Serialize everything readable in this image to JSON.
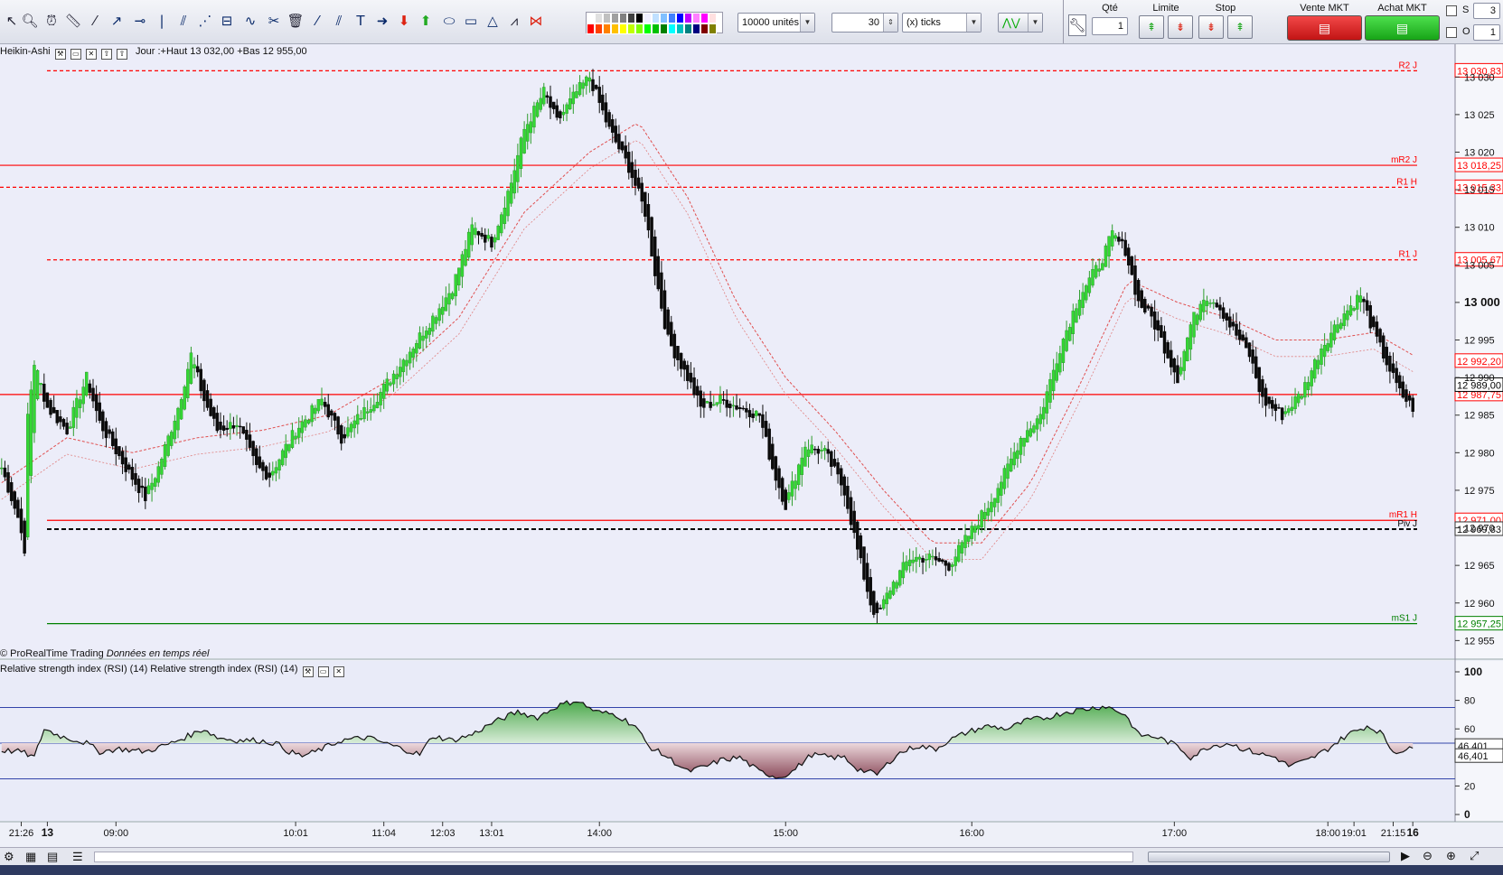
{
  "toolbar": {
    "quantity_combo": "10000 unités",
    "ticks_value": "30",
    "ticks_unit": "(x) ticks",
    "qty_label": "Qté",
    "qty_value": "1",
    "limit_label": "Limite",
    "stop_label": "Stop",
    "sell_label": "Vente MKT",
    "buy_label": "Achat MKT",
    "s_label": "S",
    "s_value": "3",
    "o_label": "O",
    "o_value": "1",
    "colors_row1": [
      "#ffffff",
      "#e0e0e0",
      "#c0c0c0",
      "#a0a0a0",
      "#808080",
      "#404040",
      "#000000",
      "#f0f0ff",
      "#c0e0ff",
      "#80c0ff",
      "#4080ff",
      "#0000ff",
      "#c000ff",
      "#ff80ff",
      "#ff00ff",
      "#ffe0e0"
    ],
    "colors_row2": [
      "#ff0000",
      "#ff4000",
      "#ff8000",
      "#ffc000",
      "#ffff00",
      "#c0ff00",
      "#80ff00",
      "#00ff00",
      "#00c000",
      "#008000",
      "#00ffff",
      "#00c0c0",
      "#008080",
      "#000080",
      "#800000",
      "#808000"
    ]
  },
  "chart_header": {
    "indicator": "Heikin-Ashi",
    "day_info": "Jour :+Haut 13 032,00 +Bas 12 955,00"
  },
  "rsi_header": {
    "title": "Relative strength index (RSI) (14) Relative strength index (RSI) (14)"
  },
  "vendor": {
    "name": "© ProRealTime Trading",
    "data_note": "Données en temps réel"
  },
  "chart_data": [
    {
      "type": "candlestick",
      "style": "Heikin-Ashi",
      "ylim": [
        12953,
        13034
      ],
      "y_ticks": [
        12955,
        12960,
        12965,
        12970,
        12975,
        12980,
        12985,
        12990,
        12995,
        13000,
        13005,
        13010,
        13015,
        13020,
        13025,
        13030
      ],
      "y_tick_labels": [
        "12 955",
        "12 960",
        "12 965",
        "12 970",
        "12 975",
        "12 980",
        "12 985",
        "12 990",
        "12 995",
        "13 000",
        "13 005",
        "13 010",
        "13 015",
        "13 020",
        "13 025",
        "13 030"
      ],
      "x_tick_labels": [
        "21:26",
        "13",
        "09:00",
        "10:01",
        "11:04",
        "12:03",
        "13:01",
        "14:00",
        "15:00",
        "16:00",
        "17:00",
        "18:00",
        "19:01",
        "21:15",
        "16"
      ],
      "levels": [
        {
          "name": "R2 J",
          "value": 13030.83,
          "label": "13 030,83",
          "color": "#ff0000",
          "style": "dashed"
        },
        {
          "name": "mR2 J",
          "value": 13018.25,
          "label": "13 018,25",
          "color": "#ff0000",
          "style": "solid"
        },
        {
          "name": "R1 H",
          "value": 13015.33,
          "label": "13 015,33",
          "color": "#ff0000",
          "style": "dashed"
        },
        {
          "name": "R1 J",
          "value": 13005.67,
          "label": "13 005,67",
          "color": "#ff0000",
          "style": "dashed"
        },
        {
          "name": "",
          "value": 12987.75,
          "label": "12 987,75",
          "color": "#ff0000",
          "style": "solid"
        },
        {
          "name": "mR1 H",
          "value": 12971.0,
          "label": "12 971,00",
          "color": "#ff0000",
          "style": "solid"
        },
        {
          "name": "Piv J",
          "value": 12969.83,
          "label": "12 969,83",
          "color": "#000000",
          "style": "dashed"
        },
        {
          "name": "mS1 J",
          "value": 12957.25,
          "label": "12 957,25",
          "color": "#008000",
          "style": "solid"
        }
      ],
      "markers": [
        {
          "value": 12992.2,
          "label": "12 992,20",
          "color": "#ff0000"
        },
        {
          "value": 12989.0,
          "label": "12 989,00",
          "color": "#000000"
        }
      ],
      "path": [
        [
          0,
          12978
        ],
        [
          3,
          12974
        ],
        [
          6,
          12970
        ],
        [
          7,
          12966
        ],
        [
          8,
          12985
        ],
        [
          10,
          12992
        ],
        [
          14,
          12986
        ],
        [
          20,
          12983
        ],
        [
          26,
          12990
        ],
        [
          30,
          12984
        ],
        [
          38,
          12978
        ],
        [
          44,
          12974
        ],
        [
          48,
          12978
        ],
        [
          54,
          12986
        ],
        [
          58,
          12993
        ],
        [
          62,
          12987
        ],
        [
          66,
          12983
        ],
        [
          72,
          12984
        ],
        [
          78,
          12978
        ],
        [
          82,
          12977
        ],
        [
          90,
          12983
        ],
        [
          98,
          12987
        ],
        [
          104,
          12982
        ],
        [
          108,
          12984
        ],
        [
          116,
          12988
        ],
        [
          124,
          12993
        ],
        [
          132,
          12998
        ],
        [
          138,
          13002
        ],
        [
          144,
          13010
        ],
        [
          150,
          13008
        ],
        [
          156,
          13016
        ],
        [
          160,
          13023
        ],
        [
          166,
          13028
        ],
        [
          170,
          13024
        ],
        [
          176,
          13028
        ],
        [
          180,
          13030
        ],
        [
          186,
          13023
        ],
        [
          192,
          13018
        ],
        [
          197,
          13012
        ],
        [
          200,
          13004
        ],
        [
          204,
          12995
        ],
        [
          210,
          12990
        ],
        [
          214,
          12986
        ],
        [
          220,
          12987
        ],
        [
          226,
          12986
        ],
        [
          232,
          12985
        ],
        [
          236,
          12978
        ],
        [
          240,
          12973
        ],
        [
          246,
          12981
        ],
        [
          252,
          12980
        ],
        [
          258,
          12975
        ],
        [
          262,
          12967
        ],
        [
          266,
          12960
        ],
        [
          268,
          12958
        ],
        [
          272,
          12962
        ],
        [
          278,
          12966
        ],
        [
          284,
          12966
        ],
        [
          290,
          12965
        ],
        [
          296,
          12969
        ],
        [
          302,
          12973
        ],
        [
          308,
          12978
        ],
        [
          312,
          12982
        ],
        [
          318,
          12985
        ],
        [
          324,
          12994
        ],
        [
          330,
          13001
        ],
        [
          336,
          13005
        ],
        [
          340,
          13009
        ],
        [
          344,
          13007
        ],
        [
          348,
          13000
        ],
        [
          352,
          12998
        ],
        [
          356,
          12994
        ],
        [
          360,
          12990
        ],
        [
          364,
          12997
        ],
        [
          368,
          13001
        ],
        [
          372,
          13000
        ],
        [
          376,
          12997
        ],
        [
          382,
          12993
        ],
        [
          386,
          12987
        ],
        [
          392,
          12985
        ],
        [
          398,
          12988
        ],
        [
          404,
          12994
        ],
        [
          410,
          12998
        ],
        [
          416,
          13001
        ],
        [
          420,
          12996
        ],
        [
          424,
          12992
        ],
        [
          428,
          12988
        ],
        [
          432,
          12986
        ]
      ],
      "sma_path": [
        [
          0,
          12976
        ],
        [
          20,
          12982
        ],
        [
          40,
          12980
        ],
        [
          60,
          12982
        ],
        [
          80,
          12983
        ],
        [
          100,
          12985
        ],
        [
          120,
          12990
        ],
        [
          140,
          12998
        ],
        [
          160,
          13012
        ],
        [
          180,
          13020
        ],
        [
          195,
          13024
        ],
        [
          210,
          13014
        ],
        [
          225,
          13000
        ],
        [
          240,
          12990
        ],
        [
          255,
          12983
        ],
        [
          270,
          12975
        ],
        [
          285,
          12968
        ],
        [
          300,
          12968
        ],
        [
          315,
          12976
        ],
        [
          330,
          12989
        ],
        [
          345,
          13003
        ],
        [
          360,
          13000
        ],
        [
          375,
          12998
        ],
        [
          390,
          12995
        ],
        [
          405,
          12995
        ],
        [
          420,
          12996
        ],
        [
          432,
          12993
        ]
      ]
    },
    {
      "type": "area",
      "name": "RSI (14)",
      "ylim": [
        0,
        100
      ],
      "y_ticks": [
        0,
        20,
        40,
        60,
        80,
        100
      ],
      "y_tick_labels": [
        "0",
        "20",
        "40",
        "60",
        "80",
        "100"
      ],
      "levels": [
        25,
        50,
        75
      ],
      "value_label": "46,401",
      "values": [
        [
          0,
          45
        ],
        [
          6,
          44
        ],
        [
          10,
          40
        ],
        [
          13,
          60
        ],
        [
          18,
          55
        ],
        [
          26,
          50
        ],
        [
          30,
          44
        ],
        [
          36,
          46
        ],
        [
          44,
          44
        ],
        [
          52,
          50
        ],
        [
          58,
          56
        ],
        [
          62,
          60
        ],
        [
          66,
          54
        ],
        [
          72,
          52
        ],
        [
          78,
          52
        ],
        [
          84,
          50
        ],
        [
          88,
          44
        ],
        [
          92,
          41
        ],
        [
          96,
          44
        ],
        [
          104,
          52
        ],
        [
          112,
          54
        ],
        [
          120,
          48
        ],
        [
          128,
          42
        ],
        [
          132,
          55
        ],
        [
          138,
          52
        ],
        [
          144,
          56
        ],
        [
          150,
          64
        ],
        [
          158,
          72
        ],
        [
          164,
          68
        ],
        [
          170,
          76
        ],
        [
          176,
          80
        ],
        [
          182,
          72
        ],
        [
          188,
          70
        ],
        [
          194,
          62
        ],
        [
          198,
          48
        ],
        [
          204,
          40
        ],
        [
          210,
          30
        ],
        [
          216,
          34
        ],
        [
          220,
          38
        ],
        [
          226,
          40
        ],
        [
          232,
          30
        ],
        [
          238,
          26
        ],
        [
          242,
          30
        ],
        [
          248,
          42
        ],
        [
          254,
          40
        ],
        [
          258,
          40
        ],
        [
          262,
          32
        ],
        [
          268,
          28
        ],
        [
          274,
          42
        ],
        [
          280,
          48
        ],
        [
          286,
          46
        ],
        [
          290,
          52
        ],
        [
          296,
          58
        ],
        [
          302,
          62
        ],
        [
          308,
          60
        ],
        [
          314,
          66
        ],
        [
          320,
          68
        ],
        [
          326,
          72
        ],
        [
          332,
          74
        ],
        [
          338,
          76
        ],
        [
          344,
          70
        ],
        [
          348,
          56
        ],
        [
          354,
          54
        ],
        [
          360,
          48
        ],
        [
          364,
          40
        ],
        [
          370,
          48
        ],
        [
          376,
          50
        ],
        [
          380,
          46
        ],
        [
          386,
          42
        ],
        [
          390,
          40
        ],
        [
          394,
          34
        ],
        [
          400,
          38
        ],
        [
          406,
          46
        ],
        [
          412,
          56
        ],
        [
          418,
          62
        ],
        [
          422,
          58
        ],
        [
          426,
          44
        ],
        [
          432,
          46
        ]
      ]
    }
  ]
}
